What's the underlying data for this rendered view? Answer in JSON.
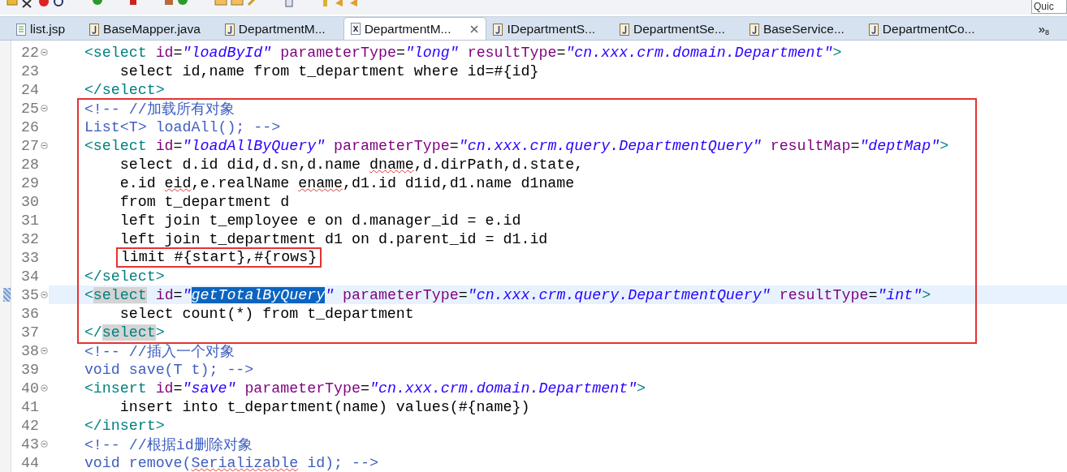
{
  "quick_access": {
    "placeholder": "Quic"
  },
  "tabs": [
    {
      "label": "list.jsp",
      "kind": "jsp",
      "selected": false
    },
    {
      "label": "BaseMapper.java",
      "kind": "java",
      "selected": false
    },
    {
      "label": "DepartmentM...",
      "kind": "java",
      "selected": false
    },
    {
      "label": "DepartmentM...",
      "kind": "xml",
      "selected": true
    },
    {
      "label": "IDepartmentS...",
      "kind": "java",
      "selected": false
    },
    {
      "label": "DepartmentSe...",
      "kind": "java",
      "selected": false
    },
    {
      "label": "BaseService...",
      "kind": "java",
      "selected": false
    },
    {
      "label": "DepartmentCo...",
      "kind": "java",
      "selected": false
    }
  ],
  "tab_overflow": {
    "glyph": "»",
    "count": "8"
  },
  "editor": {
    "segments": [
      {
        "boxed": false,
        "lines": [
          {
            "number": "22",
            "kind": "outer",
            "fold": true,
            "current": false,
            "tokens": [
              {
                "kind": "tag",
                "text": "<select"
              },
              {
                "kind": "attr",
                "text": " id"
              },
              {
                "kind": "plain",
                "text": "="
              },
              {
                "kind": "val",
                "text": "\"loadById\""
              },
              {
                "kind": "attr",
                "text": " parameterType"
              },
              {
                "kind": "plain",
                "text": "="
              },
              {
                "kind": "val",
                "text": "\"long\""
              },
              {
                "kind": "attr",
                "text": " resultType"
              },
              {
                "kind": "plain",
                "text": "="
              },
              {
                "kind": "val",
                "text": "\"cn.xxx.crm.domain.Department\""
              },
              {
                "kind": "tag",
                "text": ">"
              }
            ]
          },
          {
            "number": "23",
            "kind": "inner",
            "fold": false,
            "current": false,
            "tokens": [
              {
                "kind": "plain",
                "text": "select id,name from t_department where id=#{id}"
              }
            ]
          },
          {
            "number": "24",
            "kind": "outer",
            "fold": false,
            "current": false,
            "tokens": [
              {
                "kind": "tag",
                "text": "</select>"
              }
            ]
          }
        ]
      },
      {
        "boxed": true,
        "lines": [
          {
            "number": "25",
            "kind": "outer",
            "fold": true,
            "current": false,
            "tokens": [
              {
                "kind": "comment",
                "text": "<!-- //加载所有对象"
              }
            ]
          },
          {
            "number": "26",
            "kind": "outer",
            "fold": false,
            "current": false,
            "tokens": [
              {
                "kind": "comment",
                "text": "List<T> loadAll(); -->"
              }
            ]
          },
          {
            "number": "27",
            "kind": "outer",
            "fold": true,
            "current": false,
            "tokens": [
              {
                "kind": "tag",
                "text": "<select"
              },
              {
                "kind": "attr",
                "text": " id"
              },
              {
                "kind": "plain",
                "text": "="
              },
              {
                "kind": "val",
                "text": "\"loadAllByQuery\""
              },
              {
                "kind": "attr",
                "text": " parameterType"
              },
              {
                "kind": "plain",
                "text": "="
              },
              {
                "kind": "val",
                "text": "\"cn.xxx.crm.query.DepartmentQuery\""
              },
              {
                "kind": "attr",
                "text": " resultMap"
              },
              {
                "kind": "plain",
                "text": "="
              },
              {
                "kind": "val",
                "text": "\"deptMap\""
              },
              {
                "kind": "tag",
                "text": ">"
              }
            ]
          },
          {
            "number": "28",
            "kind": "inner",
            "fold": false,
            "current": false,
            "tokens": [
              {
                "kind": "plain",
                "text": "select d.id did,d.sn,d.name "
              },
              {
                "kind": "plain",
                "text": "dname",
                "misspelled": true
              },
              {
                "kind": "plain",
                "text": ",d.dirPath,d.state,"
              }
            ]
          },
          {
            "number": "29",
            "kind": "inner",
            "fold": false,
            "current": false,
            "tokens": [
              {
                "kind": "plain",
                "text": "e.id "
              },
              {
                "kind": "plain",
                "text": "eid",
                "misspelled": true
              },
              {
                "kind": "plain",
                "text": ",e.realName "
              },
              {
                "kind": "plain",
                "text": "ename",
                "misspelled": true
              },
              {
                "kind": "plain",
                "text": ",d1.id d1id,d1.name d1name"
              }
            ]
          },
          {
            "number": "30",
            "kind": "inner",
            "fold": false,
            "current": false,
            "tokens": [
              {
                "kind": "plain",
                "text": "from t_department d"
              }
            ]
          },
          {
            "number": "31",
            "kind": "inner",
            "fold": false,
            "current": false,
            "tokens": [
              {
                "kind": "plain",
                "text": "left join t_employee e on d.manager_id = e.id"
              }
            ]
          },
          {
            "number": "32",
            "kind": "inner",
            "fold": false,
            "current": false,
            "tokens": [
              {
                "kind": "plain",
                "text": "left join t_department d1 on d.parent_id = d1.id"
              }
            ]
          },
          {
            "number": "33",
            "kind": "inner",
            "fold": false,
            "current": false,
            "tokens": [
              {
                "kind": "plain",
                "text": "limit #{start},#{rows}",
                "boxed": true
              }
            ]
          },
          {
            "number": "34",
            "kind": "outer",
            "fold": false,
            "current": false,
            "tokens": [
              {
                "kind": "tag",
                "text": "</select>"
              }
            ]
          },
          {
            "number": "35",
            "kind": "outer",
            "fold": true,
            "current": true,
            "tokens": [
              {
                "kind": "tag",
                "text": "<"
              },
              {
                "kind": "tag",
                "text": "select",
                "marked": true
              },
              {
                "kind": "attr",
                "text": " id"
              },
              {
                "kind": "plain",
                "text": "="
              },
              {
                "kind": "val",
                "text": "\""
              },
              {
                "kind": "val",
                "text": "getTotalByQuery",
                "selected": true
              },
              {
                "kind": "val",
                "text": "\""
              },
              {
                "kind": "attr",
                "text": " parameterType"
              },
              {
                "kind": "plain",
                "text": "="
              },
              {
                "kind": "val",
                "text": "\"cn.xxx.crm.query.DepartmentQuery\""
              },
              {
                "kind": "attr",
                "text": " resultType"
              },
              {
                "kind": "plain",
                "text": "="
              },
              {
                "kind": "val",
                "text": "\"int\""
              },
              {
                "kind": "tag",
                "text": ">"
              }
            ]
          },
          {
            "number": "36",
            "kind": "inner",
            "fold": false,
            "current": false,
            "tokens": [
              {
                "kind": "plain",
                "text": "select count(*) from t_department"
              }
            ]
          },
          {
            "number": "37",
            "kind": "outer",
            "fold": false,
            "current": false,
            "tokens": [
              {
                "kind": "tag",
                "text": "</"
              },
              {
                "kind": "tag",
                "text": "select",
                "marked": true
              },
              {
                "kind": "tag",
                "text": ">"
              }
            ]
          }
        ]
      },
      {
        "boxed": false,
        "lines": [
          {
            "number": "38",
            "kind": "outer",
            "fold": true,
            "current": false,
            "tokens": [
              {
                "kind": "comment",
                "text": "<!-- //插入一个对象"
              }
            ]
          },
          {
            "number": "39",
            "kind": "outer",
            "fold": false,
            "current": false,
            "tokens": [
              {
                "kind": "comment",
                "text": "void save(T t); -->"
              }
            ]
          },
          {
            "number": "40",
            "kind": "outer",
            "fold": true,
            "current": false,
            "tokens": [
              {
                "kind": "tag",
                "text": "<insert"
              },
              {
                "kind": "attr",
                "text": " id"
              },
              {
                "kind": "plain",
                "text": "="
              },
              {
                "kind": "val",
                "text": "\"save\""
              },
              {
                "kind": "attr",
                "text": " parameterType"
              },
              {
                "kind": "plain",
                "text": "="
              },
              {
                "kind": "val",
                "text": "\"cn.xxx.crm.domain.Department\""
              },
              {
                "kind": "tag",
                "text": ">"
              }
            ]
          },
          {
            "number": "41",
            "kind": "inner",
            "fold": false,
            "current": false,
            "tokens": [
              {
                "kind": "plain",
                "text": "insert into t_department(name) values(#{name})"
              }
            ]
          },
          {
            "number": "42",
            "kind": "outer",
            "fold": false,
            "current": false,
            "tokens": [
              {
                "kind": "tag",
                "text": "</insert>"
              }
            ]
          },
          {
            "number": "43",
            "kind": "outer",
            "fold": true,
            "current": false,
            "tokens": [
              {
                "kind": "comment",
                "text": "<!-- //根据id删除对象"
              }
            ]
          },
          {
            "number": "44",
            "kind": "outer",
            "fold": false,
            "current": false,
            "tokens": [
              {
                "kind": "comment",
                "text": "void remove("
              },
              {
                "kind": "comment",
                "text": "Serializable",
                "misspelled": true
              },
              {
                "kind": "comment",
                "text": " id); -->"
              }
            ]
          }
        ]
      }
    ]
  }
}
